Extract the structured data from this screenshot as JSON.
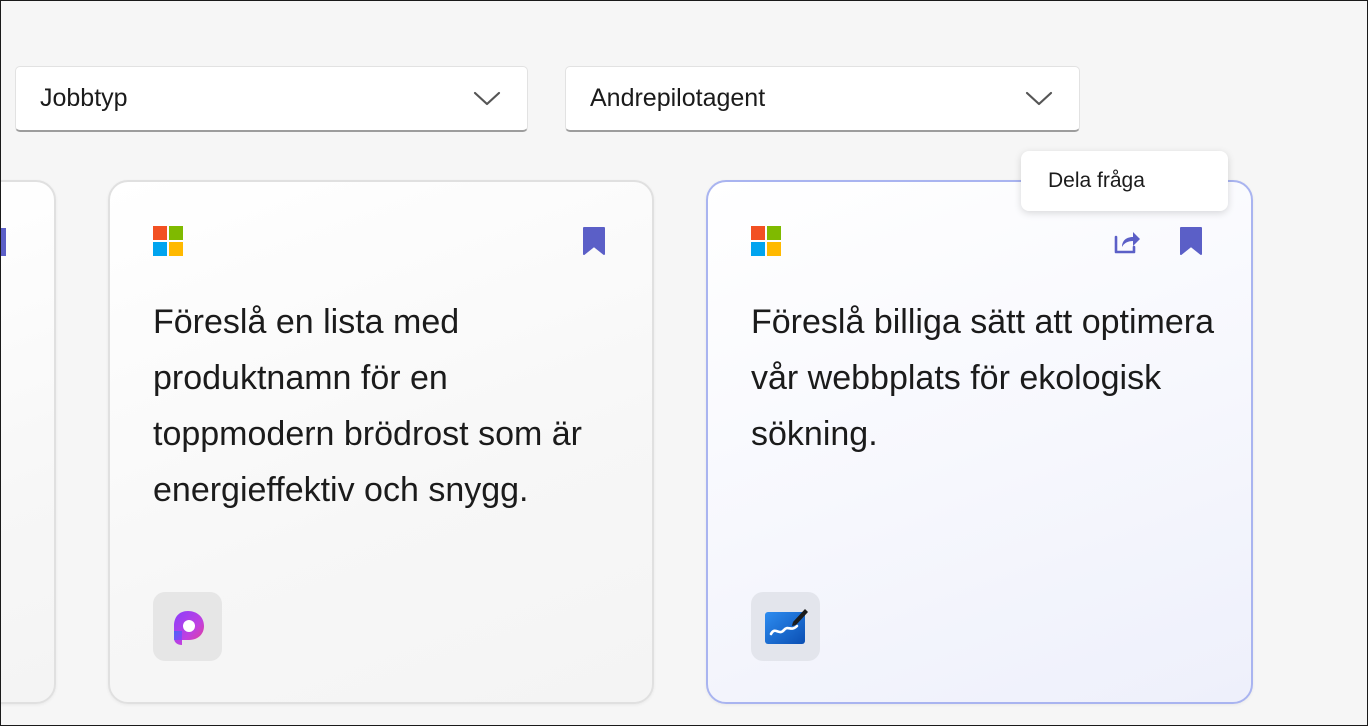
{
  "filters": {
    "job_type": {
      "label": "Jobbtyp",
      "icon": "chevron-down-icon"
    },
    "agent": {
      "label": "Andrepilotagent",
      "icon": "chevron-down-icon"
    }
  },
  "cards": [
    {
      "prompt": "Föreslå en lista med produktnamn för en toppmodern brödrost som är energieffektiv och snygg.",
      "publisher_icon": "microsoft-logo-icon",
      "app_icon": "copilot-app-icon",
      "bookmark_icon": "bookmark-icon"
    },
    {
      "prompt": "Föreslå billiga sätt att optimera vår webbplats för ekologisk sökning.",
      "publisher_icon": "microsoft-logo-icon",
      "app_icon": "whiteboard-app-icon",
      "bookmark_icon": "bookmark-icon",
      "share_icon": "share-icon"
    }
  ],
  "tooltip": {
    "text": "Dela fråga"
  },
  "colors": {
    "accent": "#5b5fc7",
    "selected_card_border": "#a9b4f0",
    "ms_red": "#f25022",
    "ms_green": "#7fba00",
    "ms_blue": "#00a4ef",
    "ms_yellow": "#ffb900"
  }
}
